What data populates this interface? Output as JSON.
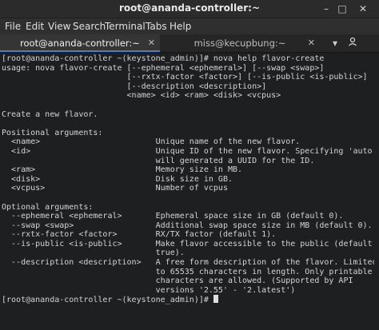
{
  "window": {
    "title": "root@ananda-controller:~"
  },
  "menubar": {
    "items": [
      "File",
      "Edit",
      "View",
      "Search",
      "Terminal",
      "Tabs",
      "Help"
    ]
  },
  "tabs": [
    {
      "label": "root@ananda-controller:~",
      "close": "✕",
      "active": true
    },
    {
      "label": "miss@kecupbung:~",
      "close": "✕",
      "active": false
    }
  ],
  "tab_actions": {
    "new_tab_icon": "add-tab-icon",
    "profile_icon": "profile-icon"
  },
  "terminal": {
    "lines": [
      "[root@ananda-controller ~(keystone_admin)]# nova help flavor-create",
      "usage: nova flavor-create [--ephemeral <ephemeral>] [--swap <swap>]",
      "                          [--rxtx-factor <factor>] [--is-public <is-public>]",
      "                          [--description <description>]",
      "                          <name> <id> <ram> <disk> <vcpus>",
      "",
      "Create a new flavor.",
      "",
      "Positional arguments:",
      "  <name>                        Unique name of the new flavor.",
      "  <id>                          Unique ID of the new flavor. Specifying 'auto'",
      "                                will generated a UUID for the ID.",
      "  <ram>                         Memory size in MB.",
      "  <disk>                        Disk size in GB.",
      "  <vcpus>                       Number of vcpus",
      "",
      "Optional arguments:",
      "  --ephemeral <ephemeral>       Ephemeral space size in GB (default 0).",
      "  --swap <swap>                 Additional swap space size in MB (default 0).",
      "  --rxtx-factor <factor>        RX/TX factor (default 1).",
      "  --is-public <is-public>       Make flavor accessible to the public (default",
      "                                true).",
      "  --description <description>   A free form description of the flavor. Limited",
      "                                to 65535 characters in length. Only printable",
      "                                characters are allowed. (Supported by API",
      "                                versions '2.55' - '2.latest')"
    ],
    "prompt": "[root@ananda-controller ~(keystone_admin)]# "
  },
  "colors": {
    "background": "#1d1f21",
    "foreground": "#d4d4d4",
    "tab_accent": "#3584e4"
  }
}
